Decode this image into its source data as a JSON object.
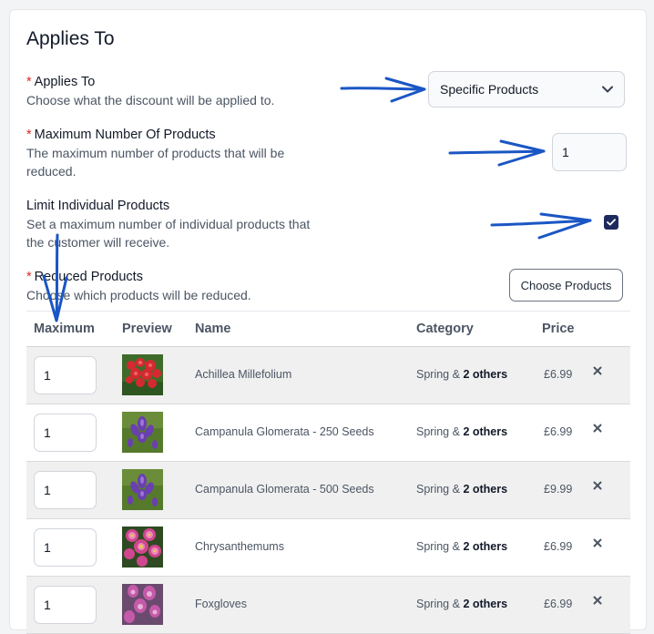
{
  "section": {
    "title": "Applies To"
  },
  "applies_to": {
    "label": "Applies To",
    "help": "Choose what the discount will be applied to.",
    "selected": "Specific Products"
  },
  "max_products": {
    "label": "Maximum Number Of Products",
    "help_line1": "The maximum number of products that will be",
    "help_line2": "reduced.",
    "value": "1"
  },
  "limit_individual": {
    "label": "Limit Individual Products",
    "help_line1": "Set a maximum number of individual products that",
    "help_line2": "the customer will receive.",
    "checked": true
  },
  "reduced_products": {
    "label": "Reduced Products",
    "help": "Choose which products will be reduced.",
    "choose_button": "Choose Products"
  },
  "required_marker": "*",
  "table": {
    "headers": {
      "maximum": "Maximum",
      "preview": "Preview",
      "name": "Name",
      "category": "Category",
      "price": "Price"
    },
    "category_joiner": "&",
    "rows": [
      {
        "max": "1",
        "name": "Achillea Millefolium",
        "category": "Spring",
        "others": "2 others",
        "price": "£6.99",
        "thumb": "red-flowers"
      },
      {
        "max": "1",
        "name": "Campanula Glomerata - 250 Seeds",
        "category": "Spring",
        "others": "2 others",
        "price": "£6.99",
        "thumb": "purple-bellflower"
      },
      {
        "max": "1",
        "name": "Campanula Glomerata - 500 Seeds",
        "category": "Spring",
        "others": "2 others",
        "price": "£9.99",
        "thumb": "purple-bellflower"
      },
      {
        "max": "1",
        "name": "Chrysanthemums",
        "category": "Spring",
        "others": "2 others",
        "price": "£6.99",
        "thumb": "pink-daisies"
      },
      {
        "max": "1",
        "name": "Foxgloves",
        "category": "Spring",
        "others": "2 others",
        "price": "£6.99",
        "thumb": "pink-foxgloves"
      }
    ]
  },
  "colors": {
    "accent": "#1e2a5e",
    "required": "#dc2626",
    "annotation_arrow": "#1a56c4"
  },
  "icons": {
    "select": "chevron-down-icon",
    "checkbox": "checkmark-icon",
    "remove": "close-icon"
  }
}
